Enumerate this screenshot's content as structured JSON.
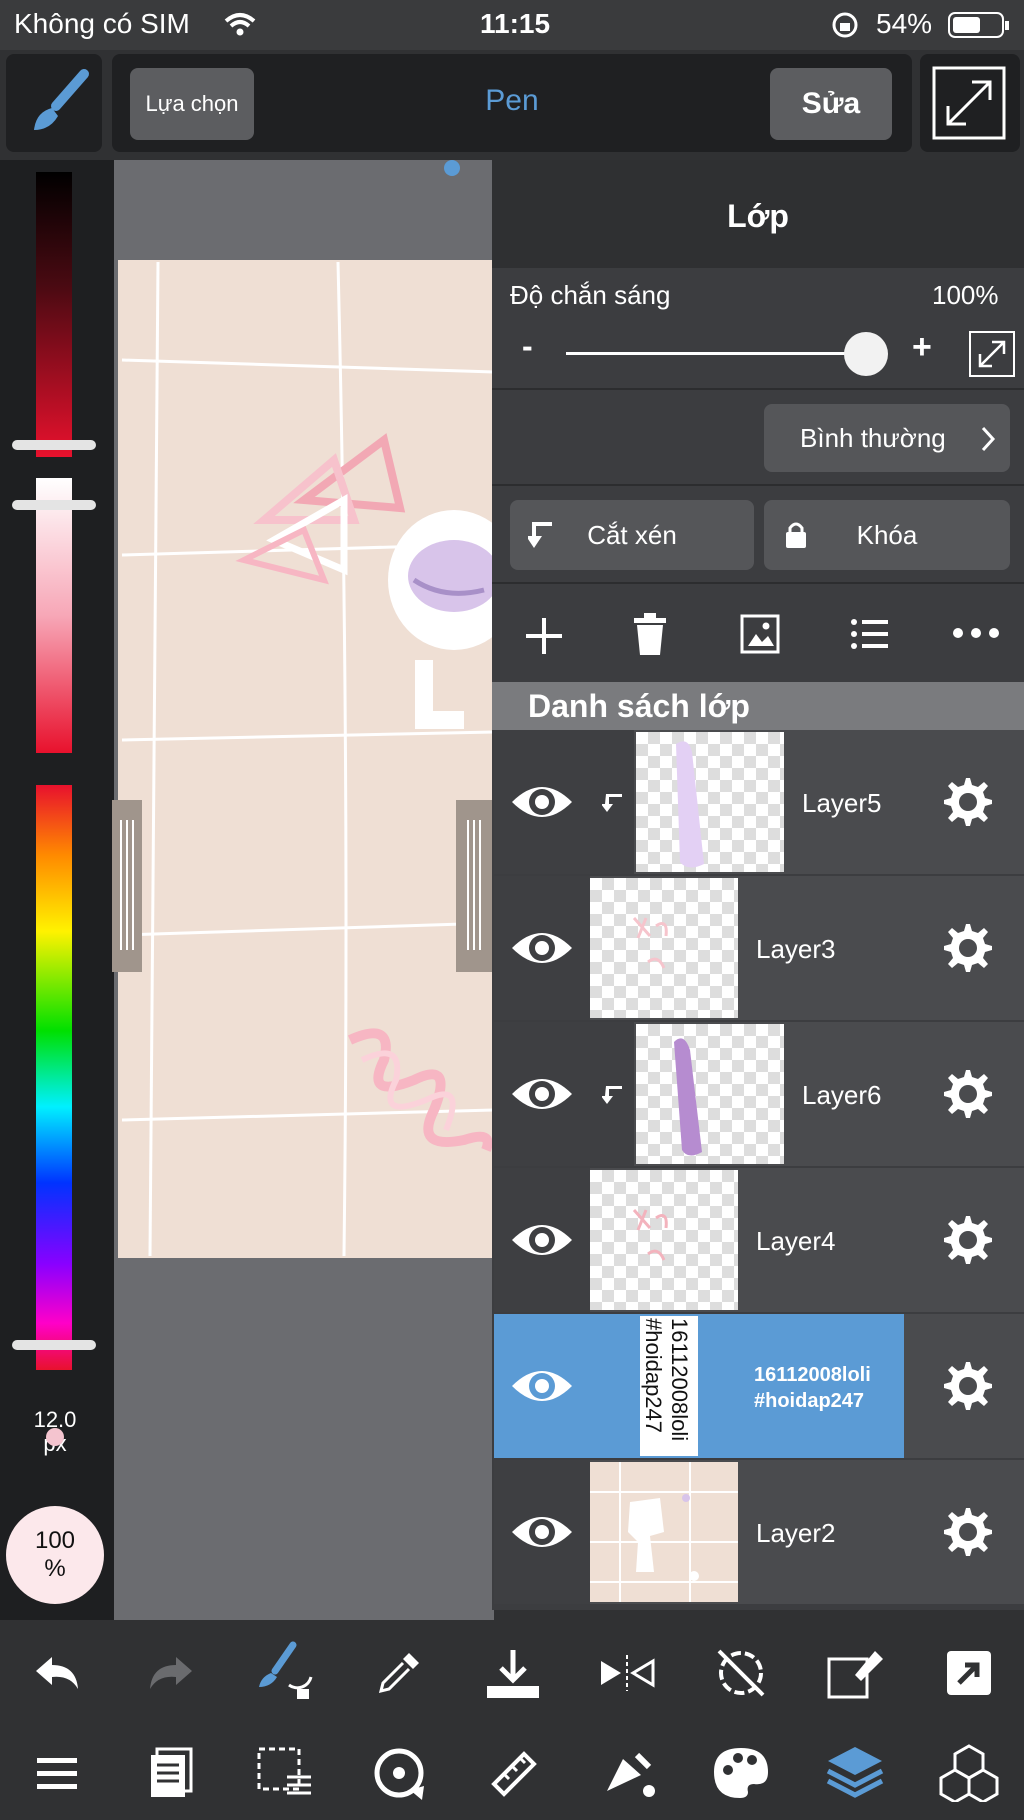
{
  "status_bar": {
    "carrier": "Không có SIM",
    "time": "11:15",
    "battery": "54%"
  },
  "top_bar": {
    "select_label": "Lựa chọn",
    "tool_name": "Pen",
    "edit_label": "Sửa"
  },
  "palette": {
    "brush_size": "12.0",
    "brush_unit": "px",
    "opacity": "100",
    "opacity_unit": "%"
  },
  "layer_panel": {
    "title": "Lớp",
    "opacity_label": "Độ chắn sáng",
    "opacity_value": "100%",
    "opacity_level": 1.0,
    "minus": "-",
    "plus": "+",
    "blend_mode": "Bình thường",
    "clip_label": "Cắt xén",
    "lock_label": "Khóa",
    "list_header": "Danh sách lớp",
    "layers": [
      {
        "name": "Layer5",
        "clipped": true,
        "selected": false
      },
      {
        "name": "Layer3",
        "clipped": false,
        "selected": false
      },
      {
        "name": "Layer6",
        "clipped": true,
        "selected": false
      },
      {
        "name": "Layer4",
        "clipped": false,
        "selected": false
      },
      {
        "name": "16112008loli\n#hoidap247",
        "clipped": false,
        "selected": true
      },
      {
        "name": "Layer2",
        "clipped": false,
        "selected": false
      }
    ],
    "text_layer_thumb_line1": "16112008loli",
    "text_layer_thumb_line2": "#hoidap247"
  },
  "colors": {
    "accent": "#5b9bd5",
    "canvas_bg": "#efdfd4",
    "panel_bg": "#3c3d40"
  },
  "icons": {
    "toolbar_row1": [
      "undo-icon",
      "redo-icon",
      "brush-swap-icon",
      "eyedropper-icon",
      "download-icon",
      "flip-icon",
      "rotate-off-icon",
      "transform-icon",
      "share-icon"
    ],
    "toolbar_row2": [
      "menu-icon",
      "pages-icon",
      "selection-icon",
      "rotate-icon",
      "ruler-icon",
      "fill-icon",
      "palette-icon",
      "layers-icon",
      "material-icon"
    ]
  }
}
